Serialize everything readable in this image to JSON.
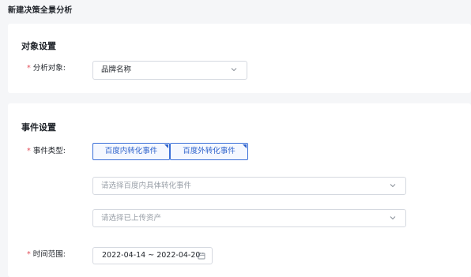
{
  "page": {
    "title": "新建决策全景分析"
  },
  "object_section": {
    "title": "对象设置",
    "field": {
      "required_mark": "*",
      "label": "分析对象:",
      "value": "品牌名称",
      "icon": "chevron-down-icon"
    }
  },
  "event_section": {
    "title": "事件设置",
    "event_type": {
      "required_mark": "*",
      "label": "事件类型:",
      "options": [
        "百度内转化事件",
        "百度外转化事件"
      ]
    },
    "select_baidu_event": {
      "placeholder": "请选择百度内具体转化事件",
      "icon": "chevron-down-icon"
    },
    "select_asset": {
      "placeholder": "请选择已上传资产",
      "icon": "chevron-down-icon"
    },
    "time_range": {
      "required_mark": "*",
      "label": "时间范围:",
      "value": "2022-04-14 ~ 2022-04-20",
      "icon": "calendar-icon"
    }
  },
  "colors": {
    "accent": "#2f63cc",
    "required": "#e34d59",
    "background": "#f5f6f8",
    "card": "#ffffff"
  }
}
